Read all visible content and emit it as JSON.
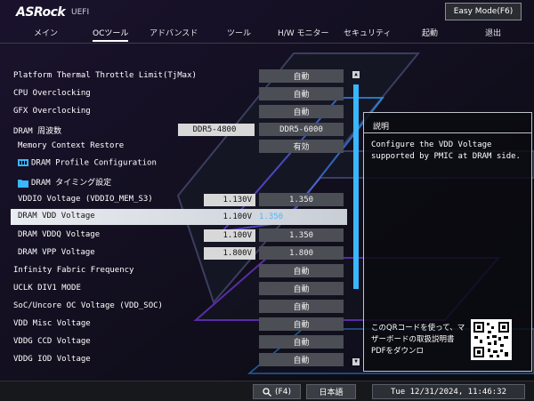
{
  "header": {
    "brand": "ASRock",
    "brand_sub": "UEFI",
    "easy_mode": "Easy Mode(F6)"
  },
  "tabs": [
    "メイン",
    "OCツール",
    "アドバンスド",
    "ツール",
    "H/W モニター",
    "セキュリティ",
    "起動",
    "退出"
  ],
  "active_tab": "OCツール",
  "rows": [
    {
      "label": "Platform Thermal Throttle Limit(TjMax)",
      "value": "自動"
    },
    {
      "label": "CPU Overclocking",
      "value": "自動"
    },
    {
      "label": "GFX Overclocking",
      "value": "自動"
    },
    {
      "label": "DRAM 周波数",
      "current": "DDR5-4800",
      "value": "DDR5-6000"
    },
    {
      "label": "Memory Context Restore",
      "value": "有効"
    },
    {
      "label": "DRAM Profile Configuration"
    },
    {
      "label": "DRAM タイミング設定"
    },
    {
      "label": "VDDIO Voltage (VDDIO_MEM_S3)",
      "current": "1.130V",
      "value": "1.350"
    },
    {
      "label": "DRAM VDD Voltage",
      "current": "1.100V",
      "value": "1.350"
    },
    {
      "label": "DRAM VDDQ Voltage",
      "current": "1.100V",
      "value": "1.350"
    },
    {
      "label": "DRAM VPP Voltage",
      "current": "1.800V",
      "value": "1.800"
    },
    {
      "label": "Infinity Fabric Frequency",
      "value": "自動"
    },
    {
      "label": "UCLK DIV1 MODE",
      "value": "自動"
    },
    {
      "label": "SoC/Uncore OC Voltage (VDD_SOC)",
      "value": "自動"
    },
    {
      "label": "VDD Misc Voltage",
      "value": "自動"
    },
    {
      "label": "VDDG CCD Voltage",
      "value": "自動"
    },
    {
      "label": "VDDG IOD Voltage",
      "value": "自動"
    }
  ],
  "help": {
    "title": "説明",
    "text": "Configure the VDD Voltage supported by PMIC at DRAM side.",
    "qr_text": "このQRコードを使って、マザーボードの取扱説明書PDFをダウンロ"
  },
  "footer": {
    "search": "(F4)",
    "language": "日本語",
    "datetime": "Tue 12/31/2024, 11:46:32"
  },
  "colors": {
    "accent": "#39b6ff",
    "highlight_row": "#e9edf2",
    "value_box": "#4b4e55"
  }
}
